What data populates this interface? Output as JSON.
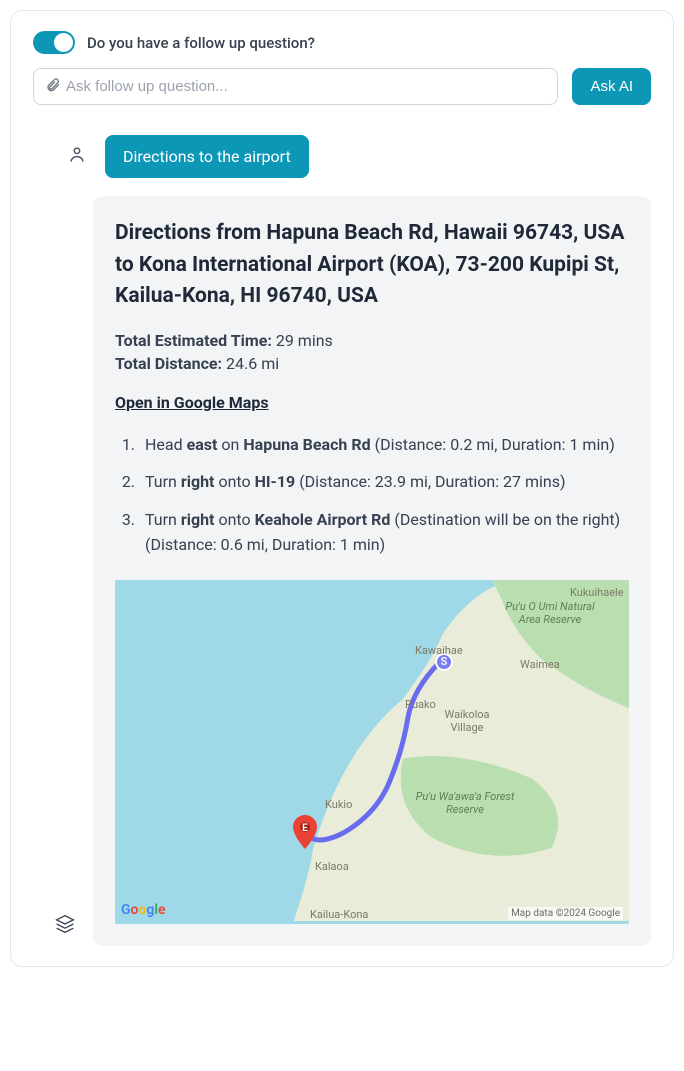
{
  "header": {
    "toggle_label": "Do you have a follow up question?",
    "input_placeholder": "Ask follow up question...",
    "ask_button": "Ask AI"
  },
  "user_query": {
    "text": "Directions to the airport"
  },
  "response": {
    "title": "Directions from Hapuna Beach Rd, Hawaii 96743, USA to Kona International Airport (KOA), 73-200 Kupipi St, Kailua-Kona, HI 96740, USA",
    "time_label": "Total Estimated Time:",
    "time_value": "29 mins",
    "distance_label": "Total Distance:",
    "distance_value": "24.6 mi",
    "gmaps_link": "Open in Google Maps",
    "steps": [
      {
        "pre": "Head ",
        "b1": "east",
        "mid": " on ",
        "b2": "Hapuna Beach Rd",
        "post": " (Distance: 0.2 mi, Duration: 1 min)"
      },
      {
        "pre": "Turn ",
        "b1": "right",
        "mid": " onto ",
        "b2": "HI-19",
        "post": " (Distance: 23.9 mi, Duration: 27 mins)"
      },
      {
        "pre": "Turn ",
        "b1": "right",
        "mid": " onto ",
        "b2": "Keahole Airport Rd",
        "post": " (Destination will be on the right) (Distance: 0.6 mi, Duration: 1 min)"
      }
    ]
  },
  "map": {
    "attribution": "Map data ©2024 Google",
    "labels": {
      "kukuihaele": "Kukuihaele",
      "puu_o_umi": "Pu'u O Umi Natural Area Reserve",
      "kawaihae": "Kawaihae",
      "waimea": "Waimea",
      "puako": "Puako",
      "waikoloa": "Waikoloa Village",
      "puu_waawaa": "Pu'u Wa'awa'a Forest Reserve",
      "kukio": "Kukio",
      "kalaoa": "Kalaoa",
      "kailua": "Kailua-Kona"
    },
    "markers": {
      "start": "S",
      "end": "E"
    }
  }
}
